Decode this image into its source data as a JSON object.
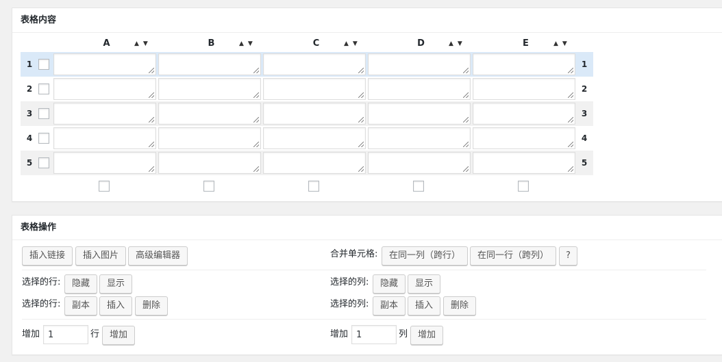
{
  "content_box": {
    "title": "表格内容",
    "columns": [
      "A",
      "B",
      "C",
      "D",
      "E"
    ],
    "sort_arrows": "▲▼",
    "rows": [
      "1",
      "2",
      "3",
      "4",
      "5"
    ],
    "selected_row_index": 0
  },
  "ops_box": {
    "title": "表格操作",
    "insert_link": "插入链接",
    "insert_image": "插入图片",
    "advanced_editor": "高级编辑器",
    "merge_label": "合并单元格:",
    "merge_same_col": "在同一列（跨行）",
    "merge_same_row": "在同一行（跨列）",
    "help": "?",
    "rows_selected_label_1": "选择的行:",
    "rows_hide": "隐藏",
    "rows_show": "显示",
    "cols_selected_label_1": "选择的列:",
    "cols_hide": "隐藏",
    "cols_show": "显示",
    "rows_selected_label_2": "选择的行:",
    "rows_copy": "副本",
    "rows_insert": "插入",
    "rows_delete": "删除",
    "cols_selected_label_2": "选择的列:",
    "cols_copy": "副本",
    "cols_insert": "插入",
    "cols_delete": "删除",
    "add_label": "增加",
    "add_rows_value": "1",
    "add_rows_unit": "行",
    "add_rows_button": "增加",
    "add_cols_value": "1",
    "add_cols_unit": "列",
    "add_cols_button": "增加"
  }
}
